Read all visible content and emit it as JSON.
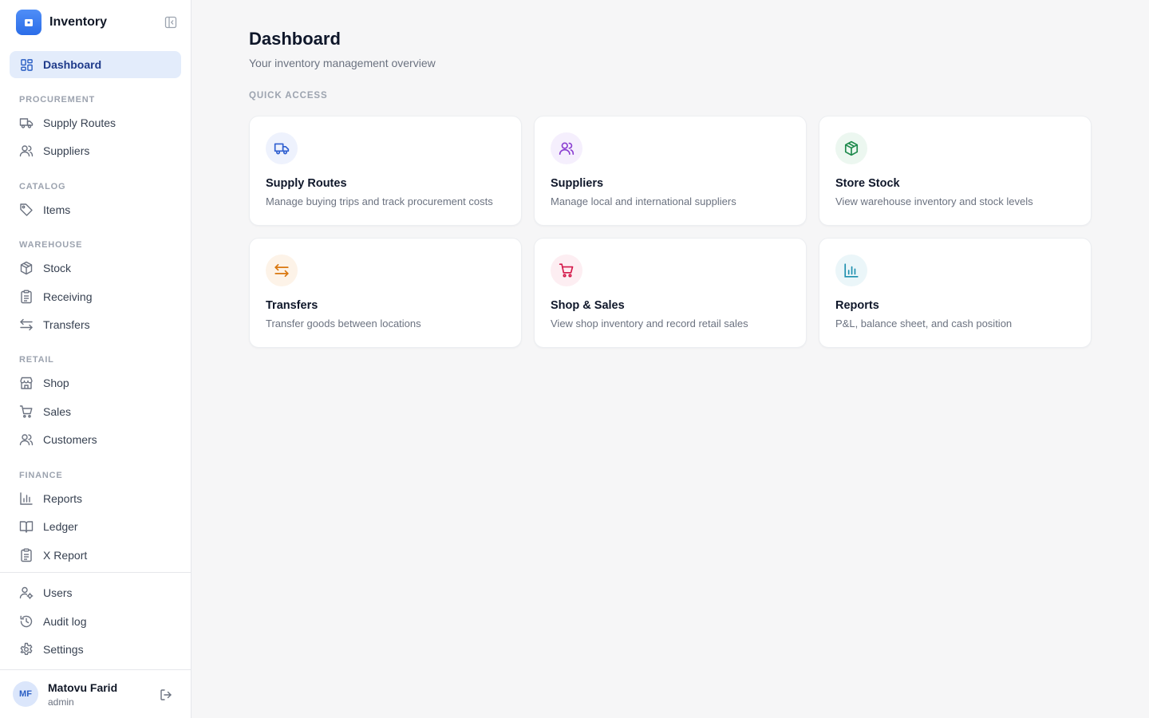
{
  "app": {
    "name": "Inventory"
  },
  "sidebar": {
    "dashboard": "Dashboard",
    "sections": {
      "procurement": "PROCUREMENT",
      "catalog": "CATALOG",
      "warehouse": "WAREHOUSE",
      "retail": "RETAIL",
      "finance": "FINANCE"
    },
    "items": {
      "supply_routes": "Supply Routes",
      "suppliers": "Suppliers",
      "items": "Items",
      "stock": "Stock",
      "receiving": "Receiving",
      "transfers": "Transfers",
      "shop": "Shop",
      "sales": "Sales",
      "customers": "Customers",
      "reports": "Reports",
      "ledger": "Ledger",
      "x_report": "X Report",
      "users": "Users",
      "audit_log": "Audit log",
      "settings": "Settings"
    },
    "user": {
      "initials": "MF",
      "name": "Matovu Farid",
      "role": "admin"
    }
  },
  "main": {
    "title": "Dashboard",
    "subtitle": "Your inventory management overview",
    "quick_access_label": "QUICK ACCESS",
    "cards": [
      {
        "title": "Supply Routes",
        "description": "Manage buying trips and track procurement costs",
        "icon": "truck-icon",
        "color": "#2f5fd0",
        "bg": "#eef2fd"
      },
      {
        "title": "Suppliers",
        "description": "Manage local and international suppliers",
        "icon": "users-icon",
        "color": "#8a3fd1",
        "bg": "#f5effd"
      },
      {
        "title": "Store Stock",
        "description": "View warehouse inventory and stock levels",
        "icon": "package-icon",
        "color": "#1e8a4c",
        "bg": "#ecf7f0"
      },
      {
        "title": "Transfers",
        "description": "Transfer goods between locations",
        "icon": "arrows-exchange-icon",
        "color": "#d9770f",
        "bg": "#fdf3e8"
      },
      {
        "title": "Shop & Sales",
        "description": "View shop inventory and record retail sales",
        "icon": "cart-icon",
        "color": "#d4194a",
        "bg": "#fdeef2"
      },
      {
        "title": "Reports",
        "description": "P&L, balance sheet, and cash position",
        "icon": "bar-chart-icon",
        "color": "#1d8fae",
        "bg": "#ebf6f9"
      }
    ]
  }
}
